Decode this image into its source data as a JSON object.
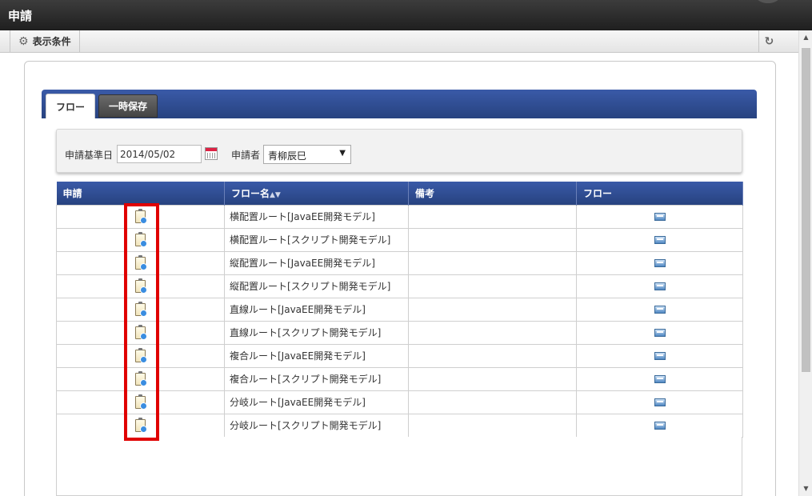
{
  "window": {
    "title": "申請"
  },
  "toolbar": {
    "display_conditions_label": "表示条件"
  },
  "tabs": [
    {
      "label": "フロー",
      "active": true
    },
    {
      "label": "一時保存",
      "active": false
    }
  ],
  "filter": {
    "date_label": "申請基準日",
    "date_value": "2014/05/02",
    "applicant_label": "申請者",
    "applicant_value": "青柳辰巳"
  },
  "table": {
    "columns": [
      "申請",
      "フロー名",
      "備考",
      "フロー"
    ],
    "sort_indicator": "▲▼",
    "rows": [
      {
        "flow_name": "横配置ルート[JavaEE開発モデル]",
        "note": ""
      },
      {
        "flow_name": "横配置ルート[スクリプト開発モデル]",
        "note": ""
      },
      {
        "flow_name": "縦配置ルート[JavaEE開発モデル]",
        "note": ""
      },
      {
        "flow_name": "縦配置ルート[スクリプト開発モデル]",
        "note": ""
      },
      {
        "flow_name": "直線ルート[JavaEE開発モデル]",
        "note": ""
      },
      {
        "flow_name": "直線ルート[スクリプト開発モデル]",
        "note": ""
      },
      {
        "flow_name": "複合ルート[JavaEE開発モデル]",
        "note": ""
      },
      {
        "flow_name": "複合ルート[スクリプト開発モデル]",
        "note": ""
      },
      {
        "flow_name": "分岐ルート[JavaEE開発モデル]",
        "note": ""
      },
      {
        "flow_name": "分岐ルート[スクリプト開発モデル]",
        "note": ""
      }
    ]
  },
  "colors": {
    "header_bg": "#2d4a92",
    "highlight": "#e00000",
    "titlebar_bg": "#2a2a2a"
  }
}
